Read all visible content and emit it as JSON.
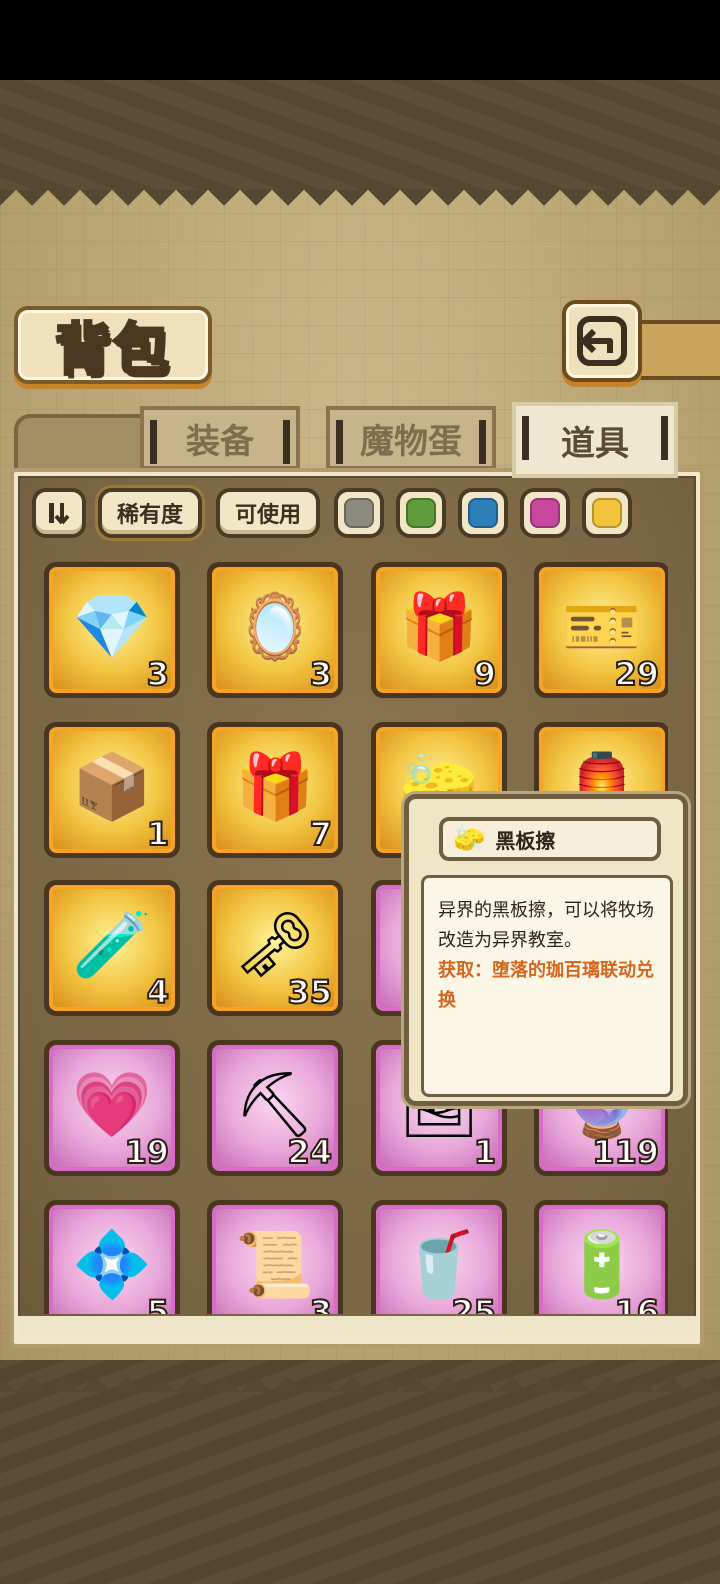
{
  "header": {
    "title": "背包"
  },
  "tabs": [
    {
      "label": "装备",
      "active": false
    },
    {
      "label": "魔物蛋",
      "active": false
    },
    {
      "label": "道具",
      "active": true
    }
  ],
  "filters": {
    "rarity_label": "稀有度",
    "usable_label": "可使用",
    "color_swatches": [
      "#8c8a7c",
      "#5f9a3b",
      "#2c7fb8",
      "#c8479f",
      "#f2c43c"
    ]
  },
  "items": [
    {
      "name": "purple-crystal",
      "icon": "💎",
      "count": "3",
      "rarity": "gold"
    },
    {
      "name": "rainbow-mirror-machine",
      "icon": "🪞",
      "count": "3",
      "rarity": "gold"
    },
    {
      "name": "ghost-gift-box-green",
      "icon": "🎁",
      "count": "9",
      "rarity": "gold"
    },
    {
      "name": "ticket",
      "icon": "🎫",
      "count": "29",
      "rarity": "gold"
    },
    {
      "name": "wooden-crate",
      "icon": "📦",
      "count": "1",
      "rarity": "gold"
    },
    {
      "name": "ghost-gift-box-rainbow",
      "icon": "🎁",
      "count": "7",
      "rarity": "gold"
    },
    {
      "name": "blackboard-eraser",
      "icon": "🧽",
      "count": "",
      "rarity": "gold"
    },
    {
      "name": "winged-lantern",
      "icon": "🏮",
      "count": "",
      "rarity": "gold"
    },
    {
      "name": "yellow-potion",
      "icon": "🧪",
      "count": "4",
      "rarity": "gold"
    },
    {
      "name": "golden-key",
      "icon": "🗝",
      "count": "35",
      "rarity": "gold"
    },
    {
      "name": "green-bottle",
      "icon": "🍾",
      "count": "",
      "rarity": "purple"
    },
    {
      "name": "hidden-item",
      "icon": "",
      "count": "",
      "rarity": "gold"
    },
    {
      "name": "winged-heart",
      "icon": "💗",
      "count": "19",
      "rarity": "purple"
    },
    {
      "name": "pickaxe",
      "icon": "⛏",
      "count": "24",
      "rarity": "purple"
    },
    {
      "name": "picture-card",
      "icon": "🖼",
      "count": "1",
      "rarity": "purple"
    },
    {
      "name": "crystal-ball",
      "icon": "🔮",
      "count": "119",
      "rarity": "purple"
    },
    {
      "name": "blue-crystal",
      "icon": "💠",
      "count": "5",
      "rarity": "purple"
    },
    {
      "name": "spell-scroll",
      "icon": "📜",
      "count": "3",
      "rarity": "purple"
    },
    {
      "name": "cola-bottle",
      "icon": "🥤",
      "count": "25",
      "rarity": "purple"
    },
    {
      "name": "black-cylinder",
      "icon": "🔋",
      "count": "16",
      "rarity": "purple"
    }
  ],
  "tooltip": {
    "name": "黑板擦",
    "description": "异界的黑板擦，可以将牧场改造为异界教室。",
    "source": "获取：堕落的珈百璃联动兑换"
  }
}
